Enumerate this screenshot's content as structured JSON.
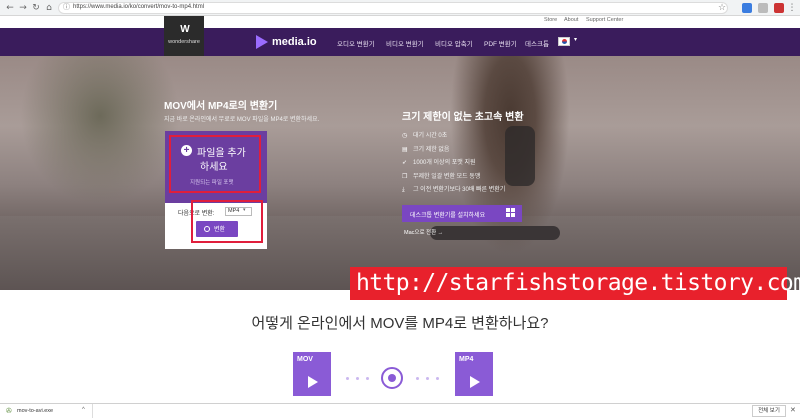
{
  "browser": {
    "url": "https://www.media.io/ko/convert/mov-to-mp4.html",
    "back": "←",
    "forward": "→",
    "reload": "↻",
    "home": "⌂",
    "lock": "ⓘ",
    "bookmark": "☆",
    "menu": "⋮"
  },
  "topbar": {
    "links": [
      "Store",
      "About",
      "Support Center"
    ]
  },
  "header": {
    "logo_mark": "W",
    "logo_text": "wondershare",
    "brand": "media.io",
    "nav": [
      "오디오 변환기",
      "비디오 변환기",
      "비디오 압축기",
      "PDF 변환기",
      "데스크톱"
    ],
    "lang_caret": "▾"
  },
  "hero": {
    "title": "MOV에서 MP4로의 변환기",
    "subtitle": "지금 바로 온라인에서 무료로 MOV 파일을 MP4로 변환하세요.",
    "upload": {
      "plus": "+",
      "label_line1": "파일을 추가",
      "label_line2": "하세요",
      "formats_link": "지원되는 파일 포맷"
    },
    "convert": {
      "to_label": "다음으로 변환:",
      "format": "MP4",
      "button": "변환"
    },
    "right": {
      "title": "크기 제한이 없는 초고속 변환",
      "features": [
        {
          "icon": "clock-icon",
          "glyph": "◷",
          "text": "대기 시간 0초"
        },
        {
          "icon": "file-icon",
          "glyph": "▤",
          "text": "크기 제한 없음"
        },
        {
          "icon": "rocket-icon",
          "glyph": "➶",
          "text": "1000개 이상의 포맷 지원"
        },
        {
          "icon": "batch-icon",
          "glyph": "❐",
          "text": "무제한 일괄 변환 모드 동맹"
        },
        {
          "icon": "download-icon",
          "glyph": "⤓",
          "text": "그 이전 변환기보다 30배 빠른 변환기"
        }
      ],
      "install_button": "데스크톱 변환기를 설치하세요",
      "mac_link": "Mac으로 전환 →"
    }
  },
  "watermark": "http://starfishstorage.tistory.com",
  "how": {
    "title": "어떻게 온라인에서 MOV를 MP4로 변환하나요?",
    "from_tag": "MOV",
    "to_tag": "MP4"
  },
  "download_bar": {
    "icon": "✇",
    "file": "mov-to-avi.exe",
    "caret": "^",
    "show_all": "전체 보기",
    "close": "✕"
  },
  "colors": {
    "nav_bg": "#3a1c5c",
    "accent": "#7a47c2",
    "highlight": "#e01e3c"
  }
}
